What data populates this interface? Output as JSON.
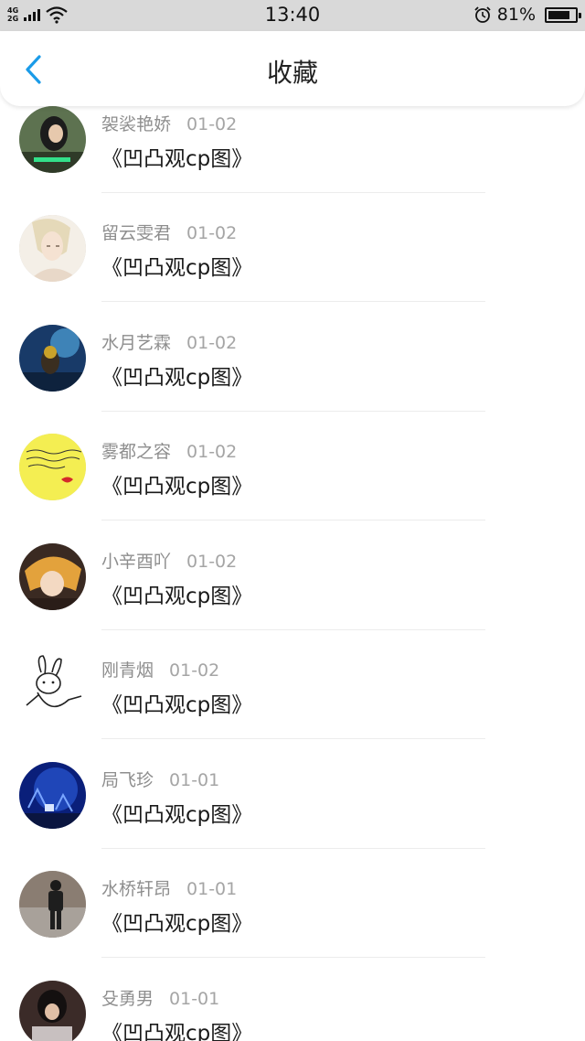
{
  "status_bar": {
    "net_top": "4G",
    "net_bottom": "2G",
    "time": "13:40",
    "battery_text": "81%",
    "battery_level": 0.81
  },
  "header": {
    "title": "收藏",
    "back_icon": "chevron-left-icon",
    "accent": "#1a9be8"
  },
  "items": [
    {
      "name": "袈裟艳娇",
      "date": "01-02",
      "title": "《凹凸观cp图》"
    },
    {
      "name": "留云雯君",
      "date": "01-02",
      "title": "《凹凸观cp图》"
    },
    {
      "name": "水月艺霖",
      "date": "01-02",
      "title": "《凹凸观cp图》"
    },
    {
      "name": "雾都之容",
      "date": "01-02",
      "title": "《凹凸观cp图》"
    },
    {
      "name": "小辛酉吖",
      "date": "01-02",
      "title": "《凹凸观cp图》"
    },
    {
      "name": "刚青烟",
      "date": "01-02",
      "title": "《凹凸观cp图》"
    },
    {
      "name": "局飞珍",
      "date": "01-01",
      "title": "《凹凸观cp图》"
    },
    {
      "name": "水桥轩昂",
      "date": "01-01",
      "title": "《凹凸观cp图》"
    },
    {
      "name": "殳勇男",
      "date": "01-01",
      "title": "《凹凸观cp图》"
    }
  ]
}
